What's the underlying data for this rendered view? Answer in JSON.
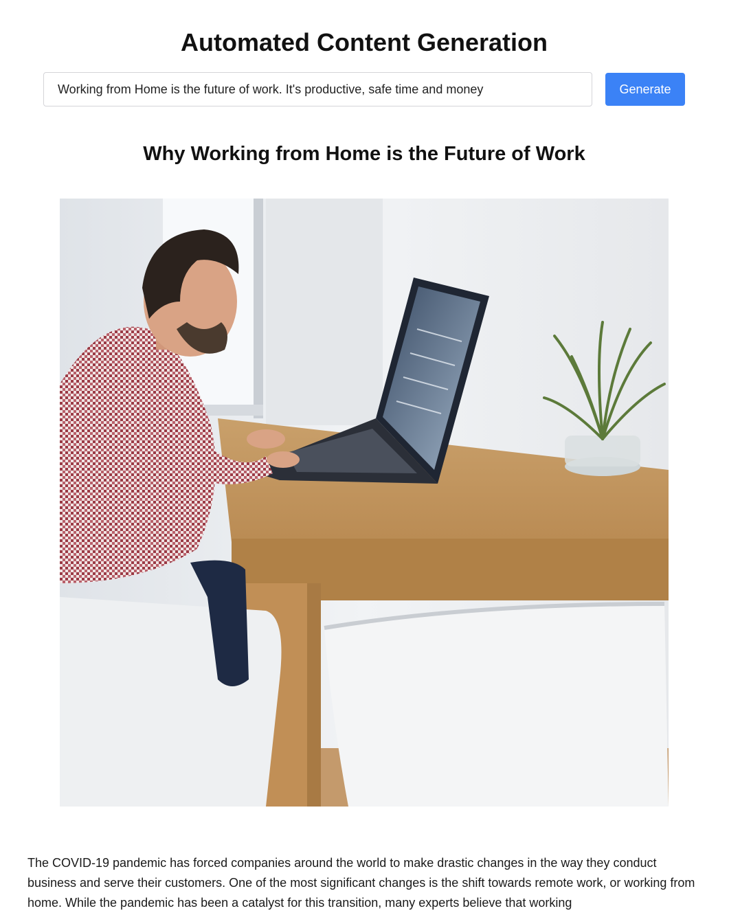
{
  "header": {
    "title": "Automated Content Generation"
  },
  "prompt": {
    "value": "Working from Home is the future of work. It's productive, safe time and money"
  },
  "toolbar": {
    "generate_label": "Generate"
  },
  "article": {
    "title": "Why Working from Home is the Future of Work",
    "image_alt": "Man in a checkered shirt typing on a laptop at a wooden table beside a window, with a potted plant and white chairs",
    "body": "The COVID-19 pandemic has forced companies around the world to make drastic changes in the way they conduct business and serve their customers. One of the most significant changes is the shift towards remote work, or working from home. While the pandemic has been a catalyst for this transition, many experts believe that working"
  },
  "colors": {
    "accent": "#3b82f6",
    "text": "#111111",
    "input_border": "#d4d4d8"
  }
}
